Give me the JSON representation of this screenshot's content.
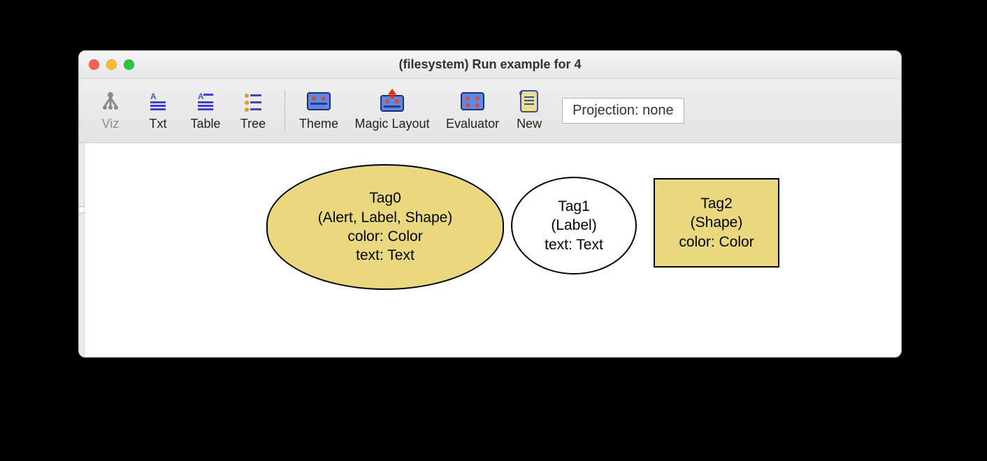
{
  "window": {
    "title": "(filesystem) Run example for 4"
  },
  "toolbar": {
    "viz_label": "Viz",
    "txt_label": "Txt",
    "table_label": "Table",
    "tree_label": "Tree",
    "theme_label": "Theme",
    "magic_layout_label": "Magic Layout",
    "evaluator_label": "Evaluator",
    "new_label": "New",
    "projection_label": "Projection: none"
  },
  "nodes": {
    "tag0": {
      "name": "Tag0",
      "sub": "(Alert, Label, Shape)",
      "line3": "color: Color",
      "line4": "text: Text"
    },
    "tag1": {
      "name": "Tag1",
      "sub": "(Label)",
      "line3": "text: Text"
    },
    "tag2": {
      "name": "Tag2",
      "sub": "(Shape)",
      "line3": "color: Color"
    }
  },
  "colors": {
    "yellow": "#ead87e"
  }
}
